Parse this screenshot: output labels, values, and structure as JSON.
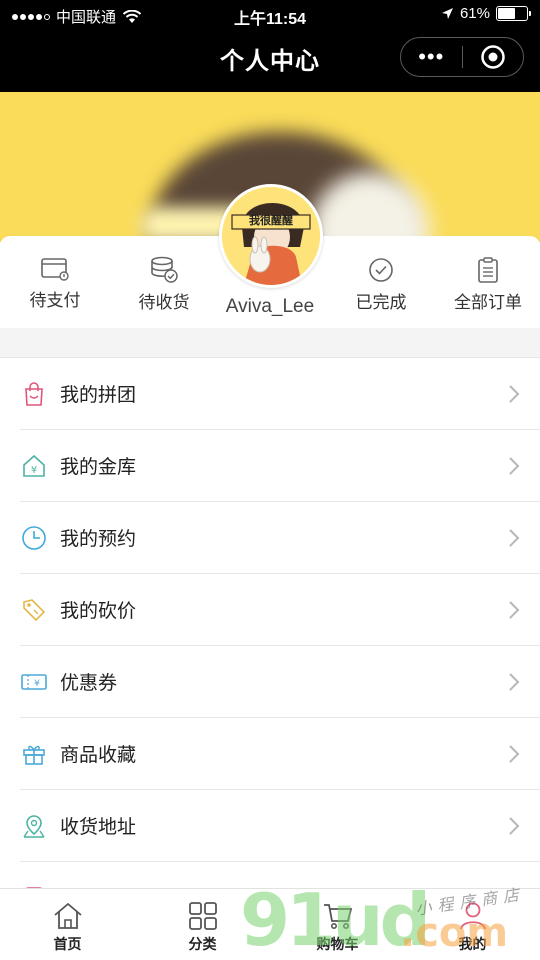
{
  "status_bar": {
    "carrier": "中国联通",
    "time": "上午11:54",
    "battery": "61%",
    "battery_level": 0.61
  },
  "nav": {
    "title": "个人中心",
    "more_label": "•••"
  },
  "profile": {
    "username": "Aviva_Lee",
    "avatar_caption": "我很醒醒"
  },
  "orders": [
    {
      "label": "待支付",
      "icon": "wallet-card-icon"
    },
    {
      "label": "待收货",
      "icon": "coin-stack-check-icon"
    },
    {
      "label": "已完成",
      "icon": "check-circle-icon"
    },
    {
      "label": "全部订单",
      "icon": "clipboard-list-icon"
    }
  ],
  "menu": [
    {
      "label": "我的拼团",
      "icon": "shopping-bag-icon",
      "color": "#e0567a"
    },
    {
      "label": "我的金库",
      "icon": "house-yen-icon",
      "color": "#4bb3a4"
    },
    {
      "label": "我的预约",
      "icon": "clock-icon",
      "color": "#3fa9d8"
    },
    {
      "label": "我的砍价",
      "icon": "price-tag-icon",
      "color": "#e6b64a"
    },
    {
      "label": "优惠券",
      "icon": "coupon-icon",
      "color": "#4aa8d8"
    },
    {
      "label": "商品收藏",
      "icon": "gift-icon",
      "color": "#4aa8d8"
    },
    {
      "label": "收货地址",
      "icon": "map-pin-icon",
      "color": "#4bb3a4"
    }
  ],
  "tabbar": [
    {
      "label": "首页",
      "icon": "home-icon"
    },
    {
      "label": "分类",
      "icon": "grid-icon"
    },
    {
      "label": "购物车",
      "icon": "cart-icon"
    },
    {
      "label": "我的",
      "icon": "user-icon"
    }
  ],
  "watermark": {
    "main": "91ud",
    "suffix": ".com",
    "script": "小程序商店"
  }
}
